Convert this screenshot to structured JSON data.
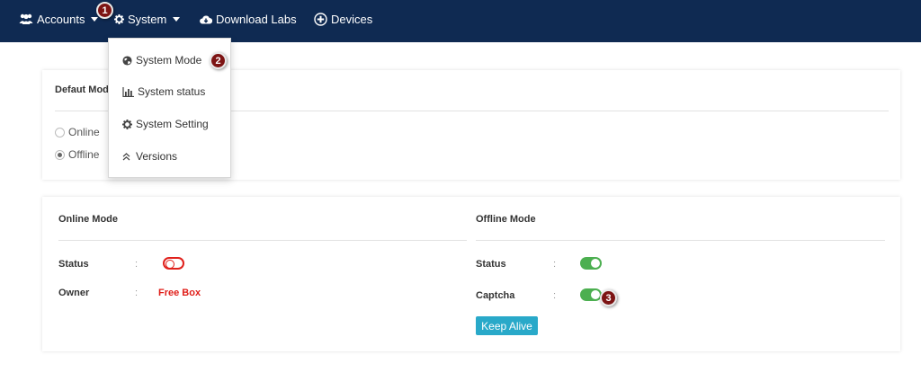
{
  "nav": {
    "accounts_label": "Accounts",
    "system_label": "System",
    "download_labs_label": "Download Labs",
    "devices_label": "Devices"
  },
  "dropdown": {
    "items": [
      {
        "label": "System Mode",
        "icon": "globe-icon"
      },
      {
        "label": "System status",
        "icon": "bar-chart-icon"
      },
      {
        "label": "System Setting",
        "icon": "gear-icon"
      },
      {
        "label": "Versions",
        "icon": "double-chevron-up-icon"
      }
    ]
  },
  "markers": [
    "1",
    "2",
    "3"
  ],
  "default_mode": {
    "title": "Defaut Mode",
    "options": [
      {
        "label": "Online",
        "checked": false
      },
      {
        "label": "Offline",
        "checked": true
      }
    ]
  },
  "online_mode": {
    "title": "Online Mode",
    "status_label": "Status",
    "status_on": false,
    "owner_label": "Owner",
    "owner_value": "Free Box",
    "colon": ":"
  },
  "offline_mode": {
    "title": "Offline Mode",
    "status_label": "Status",
    "status_on": true,
    "captcha_label": "Captcha",
    "captcha_on": true,
    "keep_alive_label": "Keep Alive",
    "colon": ":"
  },
  "colors": {
    "navbar": "#0f2a52",
    "toggle_on": "#4caf50",
    "toggle_off": "#e0201b",
    "button": "#29a9c9",
    "marker": "#7d1414"
  }
}
